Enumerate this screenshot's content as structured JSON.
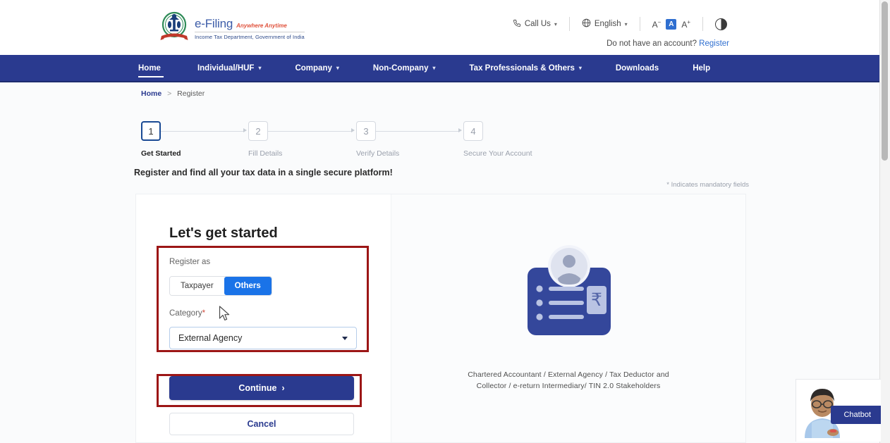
{
  "brand": {
    "emblem_icon": "india-national-emblem-icon",
    "name": "e-Filing",
    "tagline": "Anywhere Anytime",
    "department": "Income Tax Department, Government of India"
  },
  "utility": {
    "call_us": "Call Us",
    "call_icon": "phone-icon",
    "language": "English",
    "language_icon": "globe-icon",
    "font_decrease": "A",
    "font_decrease_icon": "font-decrease-icon",
    "font_normal": "A",
    "font_normal_icon": "font-normal-icon",
    "font_increase": "A",
    "font_increase_icon": "font-increase-icon",
    "contrast_icon": "contrast-icon",
    "account_prompt": "Do not have an account?",
    "register_link": "Register"
  },
  "nav": {
    "items": [
      {
        "label": "Home",
        "has_caret": false,
        "active": true
      },
      {
        "label": "Individual/HUF",
        "has_caret": true,
        "active": false
      },
      {
        "label": "Company",
        "has_caret": true,
        "active": false
      },
      {
        "label": "Non-Company",
        "has_caret": true,
        "active": false
      },
      {
        "label": "Tax Professionals & Others",
        "has_caret": true,
        "active": false
      },
      {
        "label": "Downloads",
        "has_caret": false,
        "active": false
      },
      {
        "label": "Help",
        "has_caret": false,
        "active": false
      }
    ]
  },
  "breadcrumb": {
    "home": "Home",
    "separator": ">",
    "current": "Register"
  },
  "stepper": {
    "steps": [
      {
        "number": "1",
        "label": "Get Started",
        "active": true
      },
      {
        "number": "2",
        "label": "Fill Details",
        "active": false
      },
      {
        "number": "3",
        "label": "Verify Details",
        "active": false
      },
      {
        "number": "4",
        "label": "Secure Your Account",
        "active": false
      }
    ]
  },
  "page": {
    "tagline": "Register and find all your tax data in a single secure platform!",
    "mandatory_note": "* Indicates mandatory fields"
  },
  "form": {
    "title": "Let's get started",
    "register_as_label": "Register as",
    "register_as_options": [
      "Taxpayer",
      "Others"
    ],
    "register_as_selected": "Others",
    "category_label": "Category",
    "category_required_mark": "*",
    "category_value": "External Agency",
    "continue_label": "Continue",
    "continue_arrow": "›",
    "cancel_label": "Cancel"
  },
  "illustration": {
    "icon": "id-card-with-user-and-rupee-icon",
    "caption": "Chartered Accountant / External Agency / Tax Deductor and Collector / e-return Intermediary/ TIN 2.0 Stakeholders"
  },
  "chatbot": {
    "label": "Chatbot",
    "avatar_icon": "chatbot-agent-avatar-icon"
  },
  "colors": {
    "nav_blue": "#2a3a8f",
    "accent_blue": "#1a73e8",
    "annotation_red": "#9c1616",
    "link_blue": "#2f6fd0"
  }
}
